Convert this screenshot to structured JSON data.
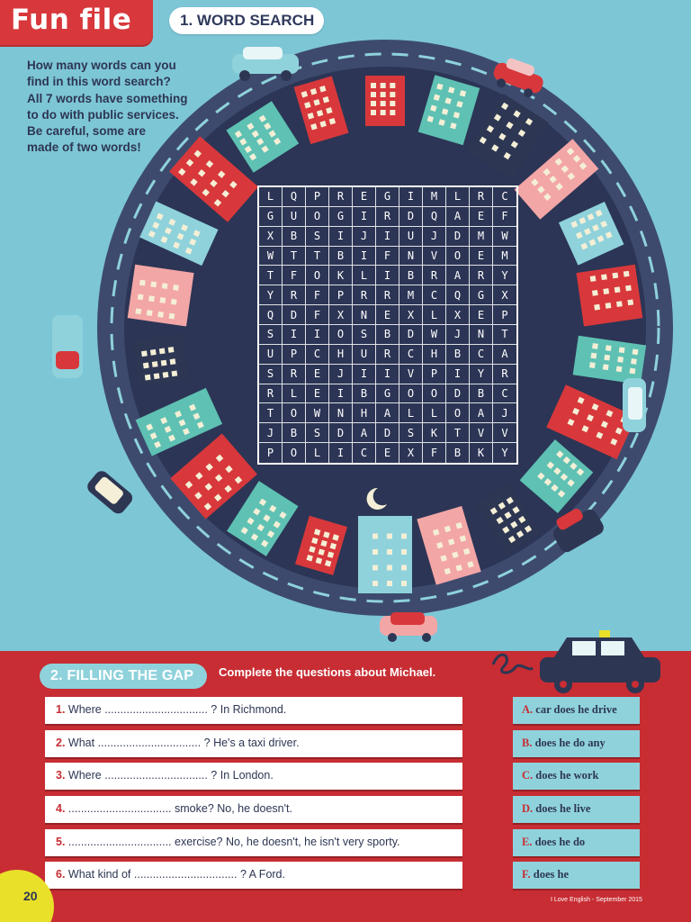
{
  "header": {
    "section": "Fun file",
    "exercise1_title": "1. WORD SEARCH"
  },
  "intro": {
    "lines": [
      "How many words can you",
      "find in this word search?",
      "All 7 words have something",
      "to do with public services.",
      "Be careful, some are",
      "made of two words!"
    ]
  },
  "word_search": {
    "rows": [
      [
        "L",
        "Q",
        "P",
        "R",
        "E",
        "G",
        "I",
        "M",
        "L",
        "R",
        "C"
      ],
      [
        "G",
        "U",
        "O",
        "G",
        "I",
        "R",
        "D",
        "Q",
        "A",
        "E",
        "F"
      ],
      [
        "X",
        "B",
        "S",
        "I",
        "J",
        "I",
        "U",
        "J",
        "D",
        "M",
        "W"
      ],
      [
        "W",
        "T",
        "T",
        "B",
        "I",
        "F",
        "N",
        "V",
        "O",
        "E",
        "M"
      ],
      [
        "T",
        "F",
        "O",
        "K",
        "L",
        "I",
        "B",
        "R",
        "A",
        "R",
        "Y"
      ],
      [
        "Y",
        "R",
        "F",
        "P",
        "R",
        "R",
        "M",
        "C",
        "Q",
        "G",
        "X"
      ],
      [
        "Q",
        "D",
        "F",
        "X",
        "N",
        "E",
        "X",
        "L",
        "X",
        "E",
        "P"
      ],
      [
        "S",
        "I",
        "I",
        "O",
        "S",
        "B",
        "D",
        "W",
        "J",
        "N",
        "T"
      ],
      [
        "U",
        "P",
        "C",
        "H",
        "U",
        "R",
        "C",
        "H",
        "B",
        "C",
        "A"
      ],
      [
        "S",
        "R",
        "E",
        "J",
        "I",
        "I",
        "V",
        "P",
        "I",
        "Y",
        "R"
      ],
      [
        "R",
        "L",
        "E",
        "I",
        "B",
        "G",
        "O",
        "O",
        "D",
        "B",
        "C"
      ],
      [
        "T",
        "O",
        "W",
        "N",
        "H",
        "A",
        "L",
        "L",
        "O",
        "A",
        "J"
      ],
      [
        "J",
        "B",
        "S",
        "D",
        "A",
        "D",
        "S",
        "K",
        "T",
        "V",
        "V"
      ],
      [
        "P",
        "O",
        "L",
        "I",
        "C",
        "E",
        "X",
        "F",
        "B",
        "K",
        "Y"
      ]
    ]
  },
  "exercise2": {
    "title": "2. FILLING THE GAP",
    "instruction": "Complete the questions about Michael.",
    "questions": [
      {
        "num": "1.",
        "text": "Where ................................. ? In Richmond."
      },
      {
        "num": "2.",
        "text": "What ................................. ? He's a taxi driver."
      },
      {
        "num": "3.",
        "text": "Where ................................. ? In London."
      },
      {
        "num": "4.",
        "text": "................................. smoke? No, he doesn't."
      },
      {
        "num": "5.",
        "text": "................................. exercise? No, he doesn't, he isn't very sporty."
      },
      {
        "num": "6.",
        "text": "What kind of ................................. ? A Ford."
      }
    ],
    "answers": [
      {
        "letter": "A.",
        "text": "car does he drive"
      },
      {
        "letter": "B.",
        "text": "does he do any"
      },
      {
        "letter": "C.",
        "text": "does he work"
      },
      {
        "letter": "D.",
        "text": "does he live"
      },
      {
        "letter": "E.",
        "text": "does he do"
      },
      {
        "letter": "F.",
        "text": "does he"
      }
    ]
  },
  "footer": {
    "page_number": "20",
    "credit": "I Love English - September 2015"
  },
  "colors": {
    "sky": "#7dc6d6",
    "red": "#d8383b",
    "navy": "#2d3653",
    "teal": "#8fd2db",
    "yellow": "#e9e02a"
  }
}
